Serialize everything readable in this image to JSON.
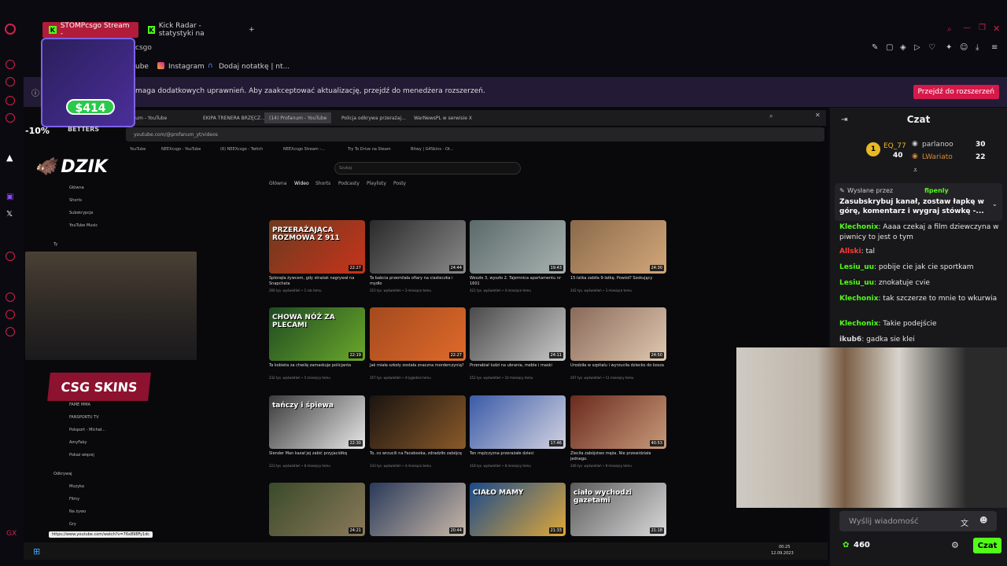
{
  "browser": {
    "tabs": [
      {
        "label": "STOMPcsgo Stream -",
        "active": true
      },
      {
        "label": "Kick Radar - statystyki na",
        "active": false
      }
    ],
    "new_tab": "+",
    "address": "csgo",
    "bookmarks": [
      "ube",
      "Instagram",
      "Dodaj notatkę | nt..."
    ],
    "notice_text": "maga dodatkowych uprawnień. Aby zaakceptować aktualizację, przejdź do menedżera rozszerzeń.",
    "notice_button": "Przejdź do rozszerzeń"
  },
  "overlay": {
    "price": "$414",
    "betters": "BETTERS",
    "dzik": "DZIK",
    "ten": "-10%",
    "csgoskins": "CSG SKINS"
  },
  "inner_browser": {
    "tabs": [
      "ntum - YouTube",
      "EKIPA TRENERA BRZĘCZ...",
      "(14) Profanum - YouTube",
      "Policja odkrywa przerażaj...",
      "WarNewsPL w serwisie X"
    ],
    "address": "youtube.com/@profanum_yt/videos",
    "bookmarks": [
      "YouTube",
      "NEEXcsgo - YouTube",
      "(6) NEEXcsgo - Twitch",
      "NEEXcsgo Stream -...",
      "Try To Drive na Steam",
      "Bitwy | G4Skins - Ot..."
    ],
    "search_placeholder": "Szukaj",
    "channel_tabs": [
      "Główna",
      "Wideo",
      "Shorts",
      "Podcasty",
      "Playlisty",
      "Posty"
    ],
    "sidebar": [
      "Główna",
      "Shorts",
      "Subskrypcje",
      "YouTube Music",
      "Ty",
      "FAME MMA",
      "FANSPORTU TV",
      "Polsport - Michał...",
      "AmyFaky",
      "Pokaż więcej",
      "Odkrywaj",
      "Muzyka",
      "Filmy",
      "Na żywo",
      "Gry"
    ],
    "status_url": "https://www.youtube.com/watch?v=76x898Fy1dc",
    "clock": "00:25",
    "date": "12.09.2023"
  },
  "videos": [
    {
      "title": "Spłonęła żywcem, gdy strażak nagrywał na Snapchata",
      "meta": "266 tys. wyświetleń • 1 rok temu",
      "overlay": "PRZERAŻAJĄCA ROZMOWA Z 911",
      "dur": "22:27",
      "c1": "#6b3a1e",
      "c2": "#c8341c"
    },
    {
      "title": "Ta babcia przemilała ofiary na ciasteczka i mydło",
      "meta": "315 tys. wyświetleń • 3 miesiące temu",
      "overlay": "",
      "dur": "24:44",
      "c1": "#2a2a2a",
      "c2": "#8a8a8a"
    },
    {
      "title": "Weszło 3, wyszło 2. Tajemnica apartamentu nr 1601",
      "meta": "421 tys. wyświetleń • 4 miesiące temu",
      "overlay": "",
      "dur": "19:43",
      "c1": "#5b6a6a",
      "c2": "#a8b3b0"
    },
    {
      "title": "15-latka zabiła 9-latkę. Powód? Szokujący",
      "meta": "242 tys. wyświetleń • 3 miesiące temu",
      "overlay": "",
      "dur": "24:30",
      "c1": "#8a6a4a",
      "c2": "#d3a77a"
    },
    {
      "title": "Ta kobieta za chwilę zamaskuje policjanta",
      "meta": "232 tys. wyświetleń • 5 miesięcy temu",
      "overlay": "CHOWA NÓŻ ZA PLECAMI",
      "dur": "22:19",
      "c1": "#1e4a22",
      "c2": "#6ba82a"
    },
    {
      "title": "Jak miała szkoły została znaczna morderczynią?",
      "meta": "357 tys. wyświetleń • 4 tygodnie temu",
      "overlay": "",
      "dur": "22:27",
      "c1": "#a34a1e",
      "c2": "#e06a2a"
    },
    {
      "title": "Przerabiał ludzi na ubrania, meble i maski",
      "meta": "252 tys. wyświetleń • 10 miesięcy temu",
      "overlay": "",
      "dur": "24:11",
      "c1": "#4a4a4a",
      "c2": "#c9c9c9"
    },
    {
      "title": "Urodziła w szpitalu i wyrzuciła dziecko do kosza",
      "meta": "297 tys. wyświetleń • 11 miesięcy temu",
      "overlay": "",
      "dur": "24:50",
      "c1": "#8a6a5a",
      "c2": "#e0c8b0"
    },
    {
      "title": "Slender Man kazał jej zabić przyjaciółkę",
      "meta": "223 tys. wyświetleń • 8 miesięcy temu",
      "overlay": "tańczy i śpiewa",
      "dur": "22:30",
      "c1": "#3a3a3a",
      "c2": "#e8e8e8"
    },
    {
      "title": "To, co wrzucili na Facebooka, zdradziło zabójcę",
      "meta": "333 tys. wyświetleń • 4 miesiące temu",
      "overlay": "",
      "dur": "",
      "c1": "#1a1410",
      "c2": "#8a5a2a"
    },
    {
      "title": "Ten mężczyzna przerażałe dzieci",
      "meta": "318 tys. wyświetleń • 8 miesięcy temu",
      "overlay": "",
      "dur": "17:46",
      "c1": "#3a5aa8",
      "c2": "#d3d3e0"
    },
    {
      "title": "Zleciła zabójstwo męża. Nie przewidziała jednego.",
      "meta": "246 tys. wyświetleń • 8 miesięcy temu",
      "overlay": "",
      "dur": "40:53",
      "c1": "#6a2a1e",
      "c2": "#c89a7a"
    },
    {
      "title": "",
      "meta": "",
      "overlay": "",
      "dur": "24:21",
      "c1": "#3a4a2a",
      "c2": "#8a7a5a"
    },
    {
      "title": "",
      "meta": "",
      "overlay": "",
      "dur": "20:44",
      "c1": "#2a3a5a",
      "c2": "#c8b8a8"
    },
    {
      "title": "",
      "meta": "",
      "overlay": "CIAŁO MAMY",
      "dur": "21:33",
      "c1": "#1a4a8a",
      "c2": "#e0a83a"
    },
    {
      "title": "",
      "meta": "",
      "overlay": "ciało wychodzi gazetami",
      "dur": "21:18",
      "c1": "#5a5a5a",
      "c2": "#dadada"
    }
  ],
  "chat": {
    "title": "Czat",
    "leaders": [
      {
        "rank": "1",
        "name": "EQ_77",
        "count": "40"
      },
      {
        "name": "parlanoo",
        "count": "30"
      },
      {
        "name": "LWariato",
        "count": "22"
      }
    ],
    "pinned_by_label": "Wysłane przez",
    "pinned_user": "fipenly",
    "pinned_text": "Zasubskrybuj kanał, zostaw łapkę w górę, komentarz i wygraj stówkę -...",
    "messages": [
      {
        "user": "Klechonix",
        "text": "Aaaa czekaj a film dziewczyna w piwnicy to jest o tym",
        "color": "#53fc18"
      },
      {
        "user": "Allski",
        "text": "tal",
        "color": "#ff3b3b"
      },
      {
        "user": "Lesiu_uu",
        "text": "pobije cie jak cie sportkam",
        "color": "#53fc18"
      },
      {
        "user": "Lesiu_uu",
        "text": "znokatuje cvie",
        "color": "#53fc18"
      },
      {
        "user": "Klechonix",
        "text": "tak szczerze to mnie to wkurwia",
        "color": "#53fc18"
      },
      {
        "user": "Klechonix",
        "text": "Takie podejście",
        "color": "#53fc18"
      },
      {
        "user": "ikub6",
        "text": "gadka sie klei",
        "color": "#d9d9d9"
      }
    ],
    "input_placeholder": "Wyślij wiadomość",
    "points": "460",
    "send_label": "Czat"
  },
  "colors": {
    "kick_green": "#53fc18",
    "opera_red": "#d3204b",
    "chat_bg": "#18181b"
  }
}
